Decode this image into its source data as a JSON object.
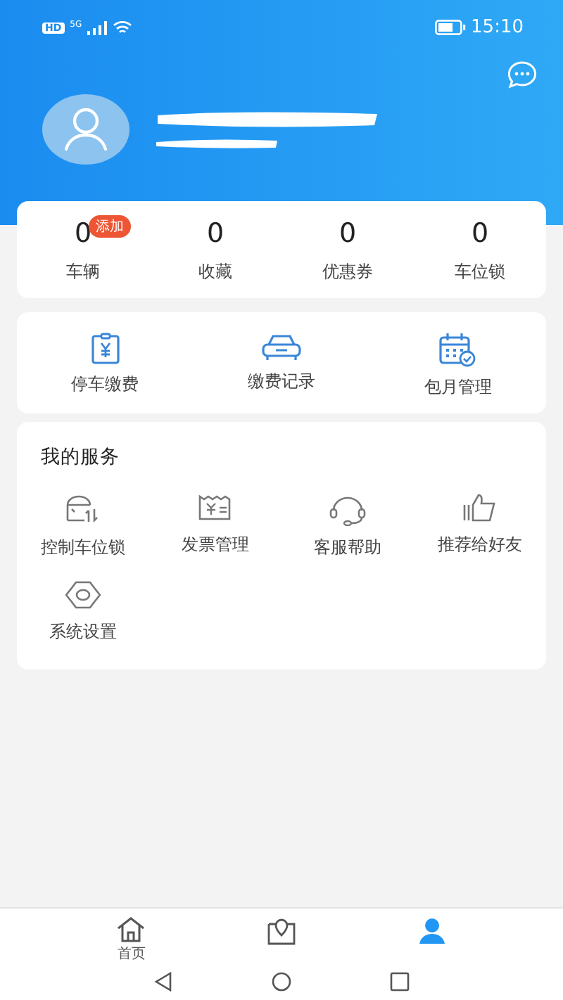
{
  "status_bar": {
    "badge": "HD",
    "network": "5G",
    "time": "15:10"
  },
  "stats": [
    {
      "value": "0",
      "label": "车辆",
      "badge": "添加"
    },
    {
      "value": "0",
      "label": "收藏"
    },
    {
      "value": "0",
      "label": "优惠券"
    },
    {
      "value": "0",
      "label": "车位锁"
    }
  ],
  "quick_actions": [
    {
      "label": "停车缴费"
    },
    {
      "label": "缴费记录"
    },
    {
      "label": "包月管理"
    }
  ],
  "services": {
    "title": "我的服务",
    "items": [
      {
        "label": "控制车位锁"
      },
      {
        "label": "发票管理"
      },
      {
        "label": "客服帮助"
      },
      {
        "label": "推荐给好友"
      },
      {
        "label": "系统设置"
      }
    ]
  },
  "tab_bar": [
    {
      "label": "首页",
      "selected": false
    },
    {
      "selected": false
    },
    {
      "selected": true
    }
  ]
}
